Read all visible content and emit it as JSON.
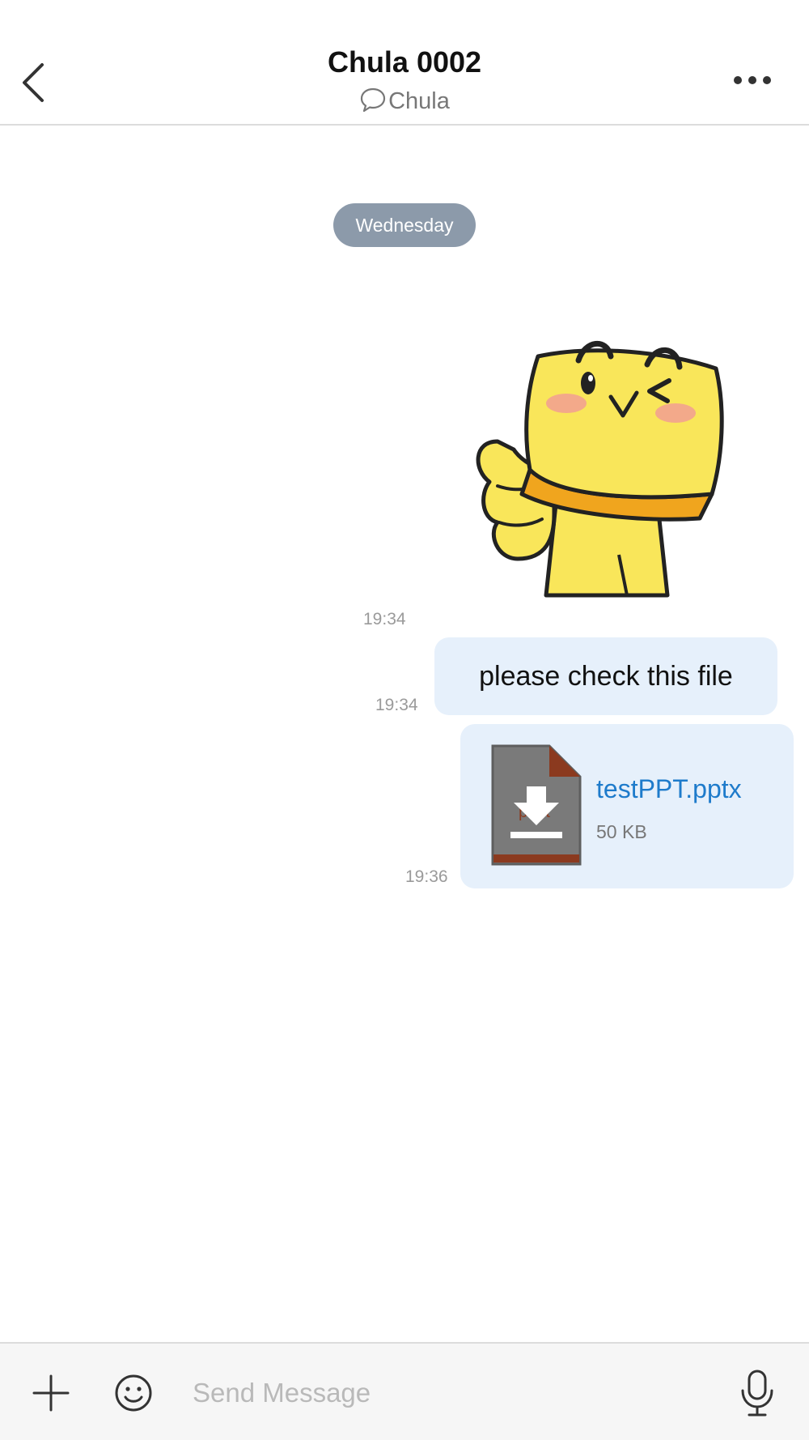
{
  "header": {
    "title": "Chula 0002",
    "subtitle": "Chula",
    "icons": {
      "back": "chevron-left-icon",
      "chat": "chat-bubble-icon",
      "more": "more-horizontal-icon"
    }
  },
  "conversation": {
    "day_label": "Wednesday",
    "messages": [
      {
        "type": "sticker",
        "sticker_icon": "yellow-cheese-character-thumbs-up-sticker",
        "time": "19:34"
      },
      {
        "type": "text",
        "text": "please check this file",
        "time": "19:34"
      },
      {
        "type": "file",
        "file_name": "testPPT.pptx",
        "file_size": "50 KB",
        "file_icon": "pptx-file-download-icon",
        "time": "19:36"
      }
    ]
  },
  "input_bar": {
    "placeholder": "Send Message",
    "icons": {
      "add": "plus-icon",
      "emoji": "smiley-icon",
      "voice": "microphone-icon"
    }
  },
  "colors": {
    "bubble_bg": "#e6f0fb",
    "link_blue": "#1e7bcb",
    "day_pill_bg": "#8c9aaa",
    "timestamp_gray": "#9a9a9a",
    "file_icon_gray": "#7a7a7a",
    "file_icon_accent": "#8b3a1f"
  }
}
